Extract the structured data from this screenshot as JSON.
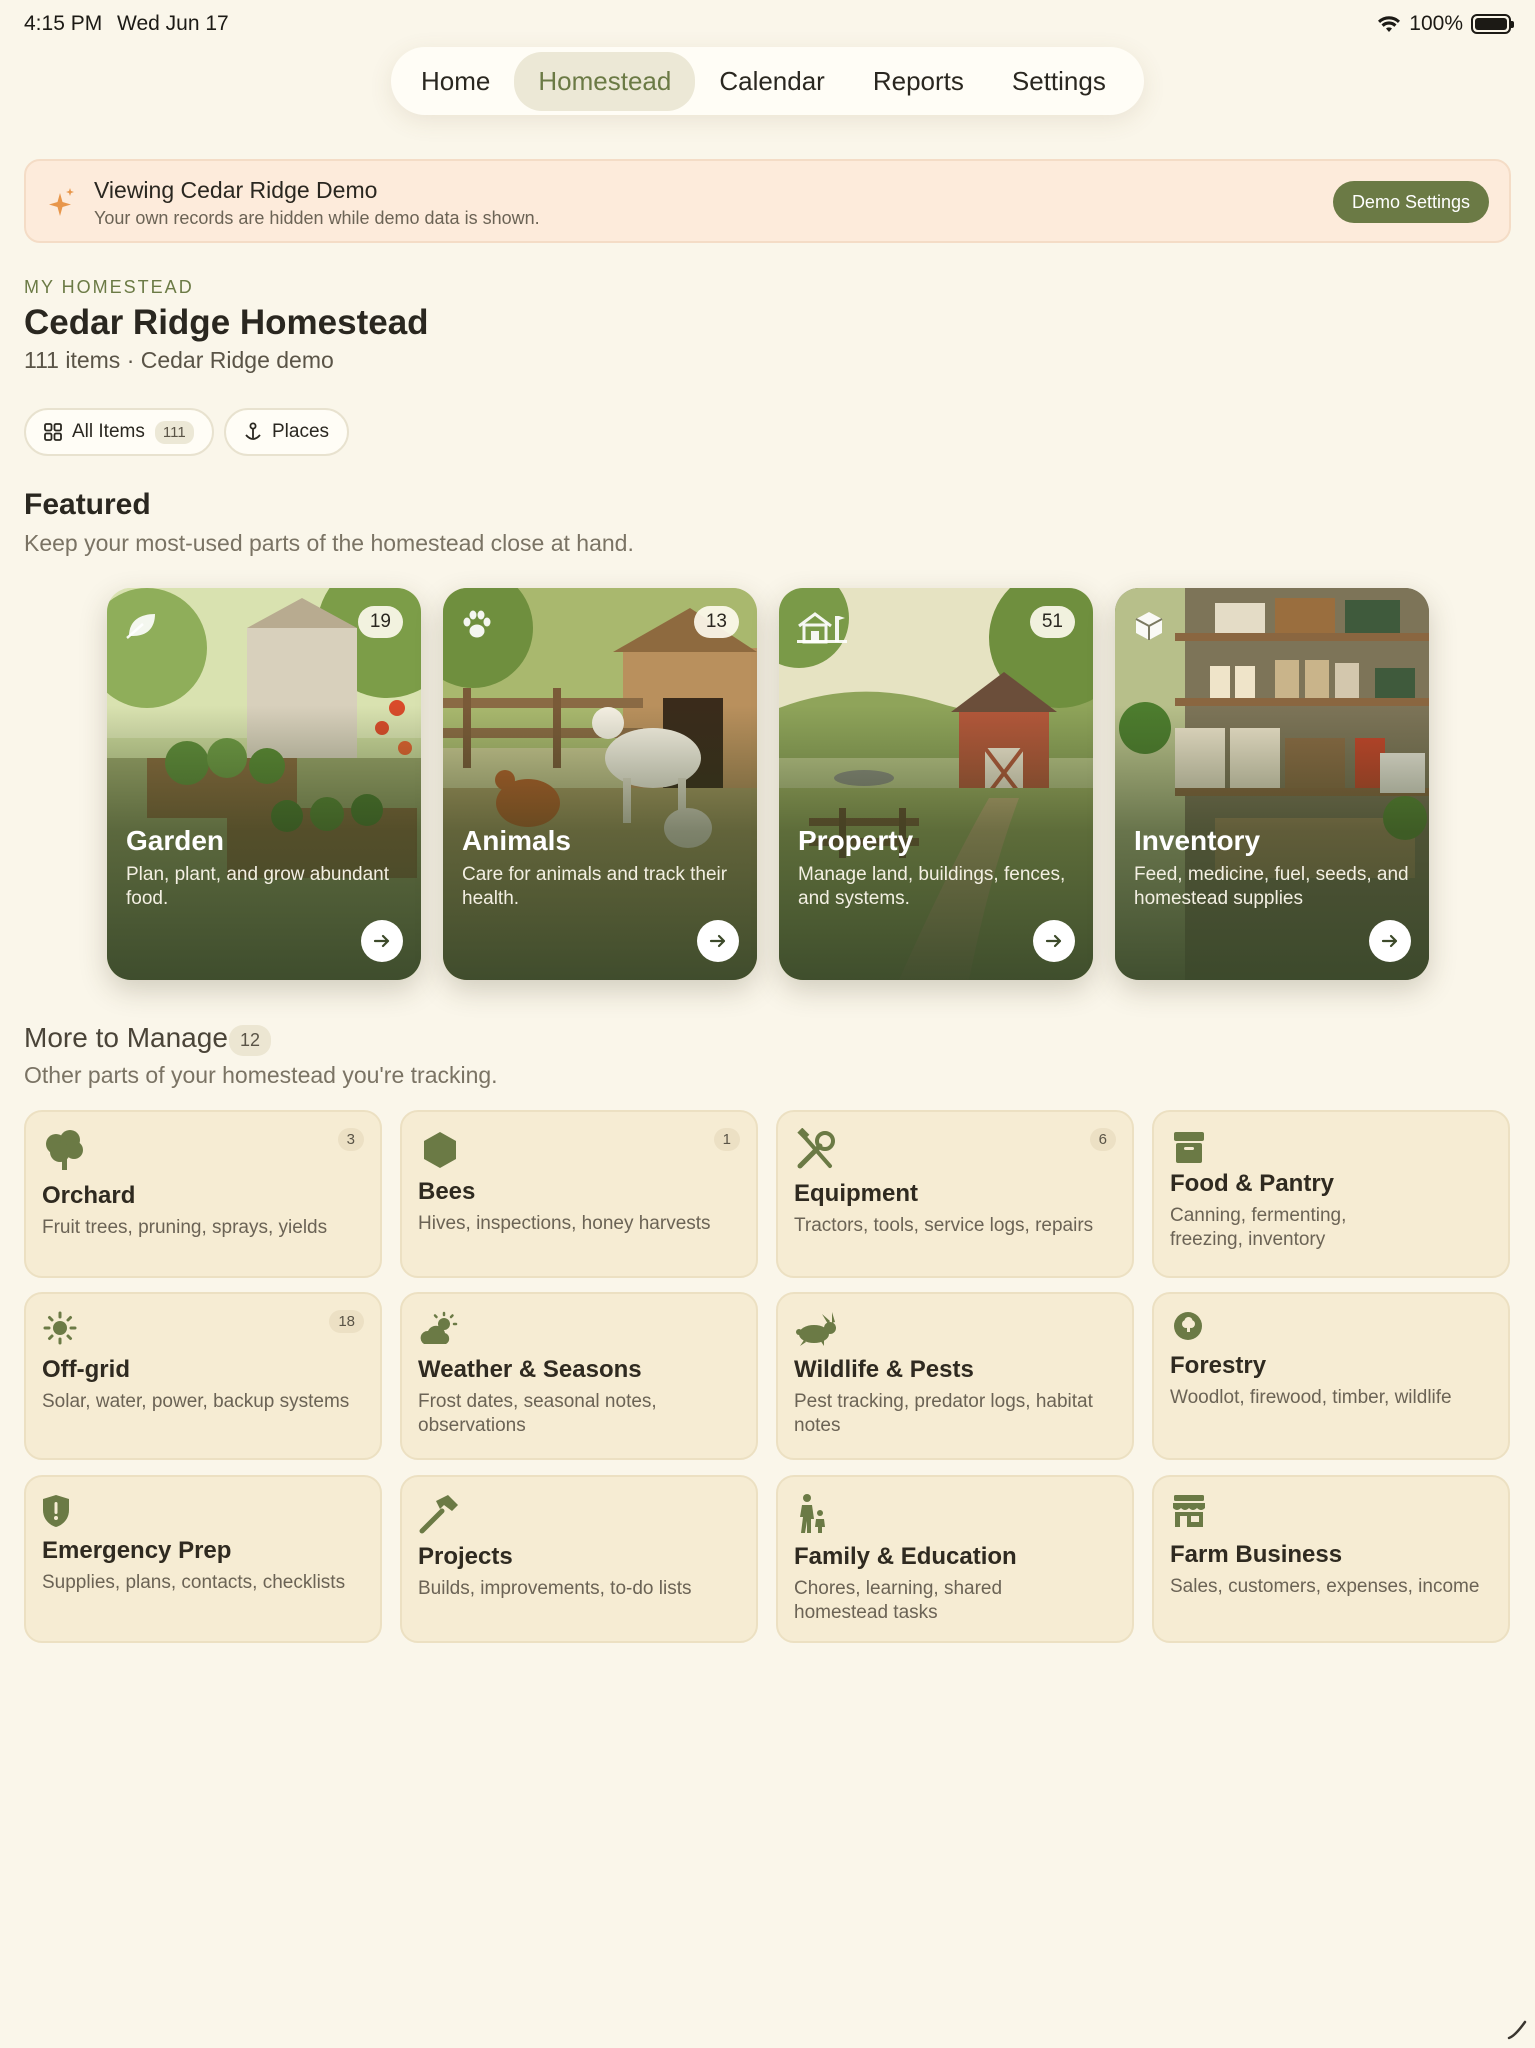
{
  "status_bar": {
    "time": "4:15 PM",
    "date": "Wed Jun 17",
    "battery": "100%"
  },
  "nav": {
    "tabs": [
      {
        "label": "Home"
      },
      {
        "label": "Homestead"
      },
      {
        "label": "Calendar"
      },
      {
        "label": "Reports"
      },
      {
        "label": "Settings"
      }
    ],
    "active": "Homestead"
  },
  "banner": {
    "title": "Viewing Cedar Ridge Demo",
    "subtitle": "Your own records are hidden while demo data is shown.",
    "button_label": "Demo Settings"
  },
  "header": {
    "eyebrow": "MY HOMESTEAD",
    "title": "Cedar Ridge Homestead",
    "subtitle": "111 items · Cedar Ridge demo"
  },
  "filters": {
    "all_items_label": "All Items",
    "all_items_count": "111",
    "places_label": "Places"
  },
  "featured": {
    "title": "Featured",
    "subtitle": "Keep your most-used parts of the homestead close at hand.",
    "cards": [
      {
        "name": "Garden",
        "count": "19",
        "description": "Plan, plant, and grow abundant food.",
        "icon": "leaf-icon"
      },
      {
        "name": "Animals",
        "count": "13",
        "description": "Care for animals and track their health.",
        "icon": "paw-icon"
      },
      {
        "name": "Property",
        "count": "51",
        "description": "Manage land, buildings, fences, and systems.",
        "icon": "farmhouse-icon"
      },
      {
        "name": "Inventory",
        "count": "",
        "description": "Feed, medicine, fuel, seeds, and homestead supplies",
        "icon": "box-icon"
      }
    ]
  },
  "more": {
    "title": "More to Manage",
    "count": "12",
    "subtitle": "Other parts of your homestead you're tracking.",
    "tiles": [
      {
        "name": "Orchard",
        "count": "3",
        "description": "Fruit trees, pruning, sprays, yields",
        "icon": "tree-icon"
      },
      {
        "name": "Bees",
        "count": "1",
        "description": "Hives, inspections, honey harvests",
        "icon": "hexagon-icon"
      },
      {
        "name": "Equipment",
        "count": "6",
        "description": "Tractors, tools, service logs, repairs",
        "icon": "tools-icon"
      },
      {
        "name": "Food & Pantry",
        "count": "",
        "description": "Canning, fermenting, freezing, inventory",
        "icon": "archive-icon"
      },
      {
        "name": "Off-grid",
        "count": "18",
        "description": "Solar, water, power, backup systems",
        "icon": "sun-icon"
      },
      {
        "name": "Weather & Seasons",
        "count": "",
        "description": "Frost dates, seasonal notes, observations",
        "icon": "cloud-sun-icon"
      },
      {
        "name": "Wildlife & Pests",
        "count": "",
        "description": "Pest tracking, predator logs, habitat notes",
        "icon": "rabbit-icon"
      },
      {
        "name": "Forestry",
        "count": "",
        "description": "Woodlot, firewood, timber, wildlife",
        "icon": "forest-icon"
      },
      {
        "name": "Emergency Prep",
        "count": "",
        "description": "Supplies, plans, contacts, checklists",
        "icon": "shield-icon"
      },
      {
        "name": "Projects",
        "count": "",
        "description": "Builds, improvements, to-do lists",
        "icon": "hammer-icon"
      },
      {
        "name": "Family & Education",
        "count": "",
        "description": "Chores, learning, shared homestead tasks",
        "icon": "family-icon"
      },
      {
        "name": "Farm Business",
        "count": "",
        "description": "Sales, customers, expenses, income",
        "icon": "storefront-icon"
      }
    ]
  },
  "colors": {
    "accent": "#6b7a45",
    "background": "#faf6ea",
    "tile": "#f6ecd3",
    "banner": "#fdebdb"
  }
}
